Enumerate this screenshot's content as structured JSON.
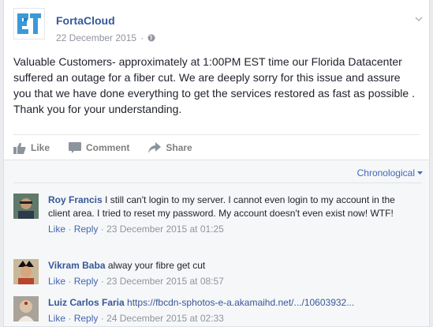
{
  "post": {
    "page_name": "FortaCloud",
    "date": "22 December 2015",
    "privacy_icon": "globe-icon",
    "text": "Valuable Customers- approximately at 1:00PM EST time our Florida Datacenter suffered an outage for a fiber cut. We are deeply sorry for this issue and assure you that we have done everything to get the services restored as fast as possible . Thank you for your understanding."
  },
  "actions": {
    "like": "Like",
    "comment": "Comment",
    "share": "Share"
  },
  "comments_section": {
    "sort_label": "Chronological",
    "comments": [
      {
        "author": "Roy Francis",
        "text": "I still can't login to my server. I cannot even login to my account in the client area. I tried to reset my password. My account doesn't even exist now! WTF!",
        "like": "Like",
        "reply": "Reply",
        "time": "23 December 2015 at 01:25"
      },
      {
        "author": "Vikram Baba",
        "text": "alway your fibre get cut",
        "like": "Like",
        "reply": "Reply",
        "time": "23 December 2015 at 08:57"
      },
      {
        "author": "Luiz Carlos Faria",
        "text": "https://fbcdn-sphotos-e-a.akamaihd.net/.../10603932...",
        "like": "Like",
        "reply": "Reply",
        "time": "24 December 2015 at 02:33"
      }
    ]
  },
  "colors": {
    "link": "#365899",
    "meta": "#90949c",
    "brand": "#3a9ad9"
  }
}
